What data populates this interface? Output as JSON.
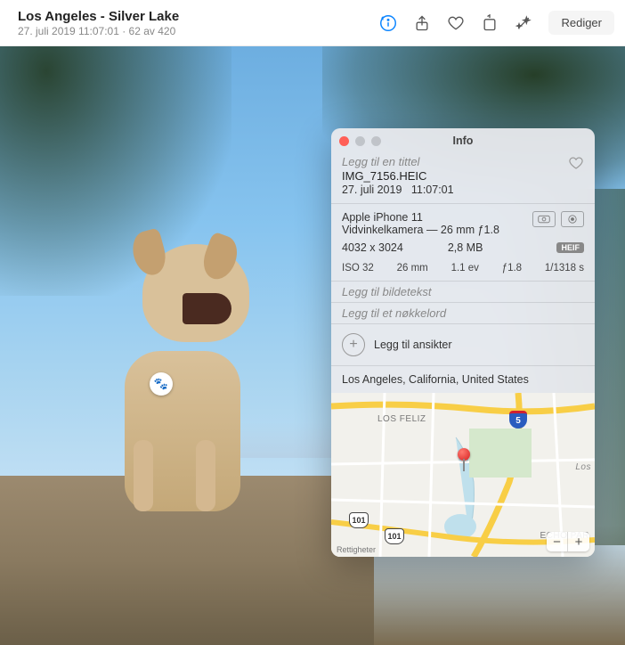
{
  "header": {
    "title": "Los Angeles - Silver Lake",
    "subtitle": "27. juli 2019 11:07:01  ·  62 av 420",
    "edit_label": "Rediger"
  },
  "info": {
    "panel_title": "Info",
    "title_placeholder": "Legg til en tittel",
    "filename": "IMG_7156.HEIC",
    "date": "27. juli 2019",
    "time": "11:07:01",
    "camera_model": "Apple iPhone 11",
    "lens": "Vidvinkelkamera — 26 mm ƒ1.8",
    "dimensions": "4032 x 3024",
    "filesize": "2,8 MB",
    "format_badge": "HEIF",
    "exif": {
      "iso": "ISO 32",
      "focal": "26 mm",
      "ev": "1.1 ev",
      "aperture": "ƒ1.8",
      "shutter": "1/1318 s"
    },
    "caption_placeholder": "Legg til bildetekst",
    "keyword_placeholder": "Legg til et nøkkelord",
    "faces_label": "Legg til ansikter",
    "location": "Los Angeles, California, United States"
  },
  "map": {
    "label_losfeliz": "LOS FELIZ",
    "label_echopark": "ECHO PAR",
    "label_los": "Los",
    "shield_101_a": "101",
    "shield_101_b": "101",
    "shield_i5": "5",
    "rights": "Rettigheter",
    "zoom_out": "−",
    "zoom_in": "+"
  }
}
